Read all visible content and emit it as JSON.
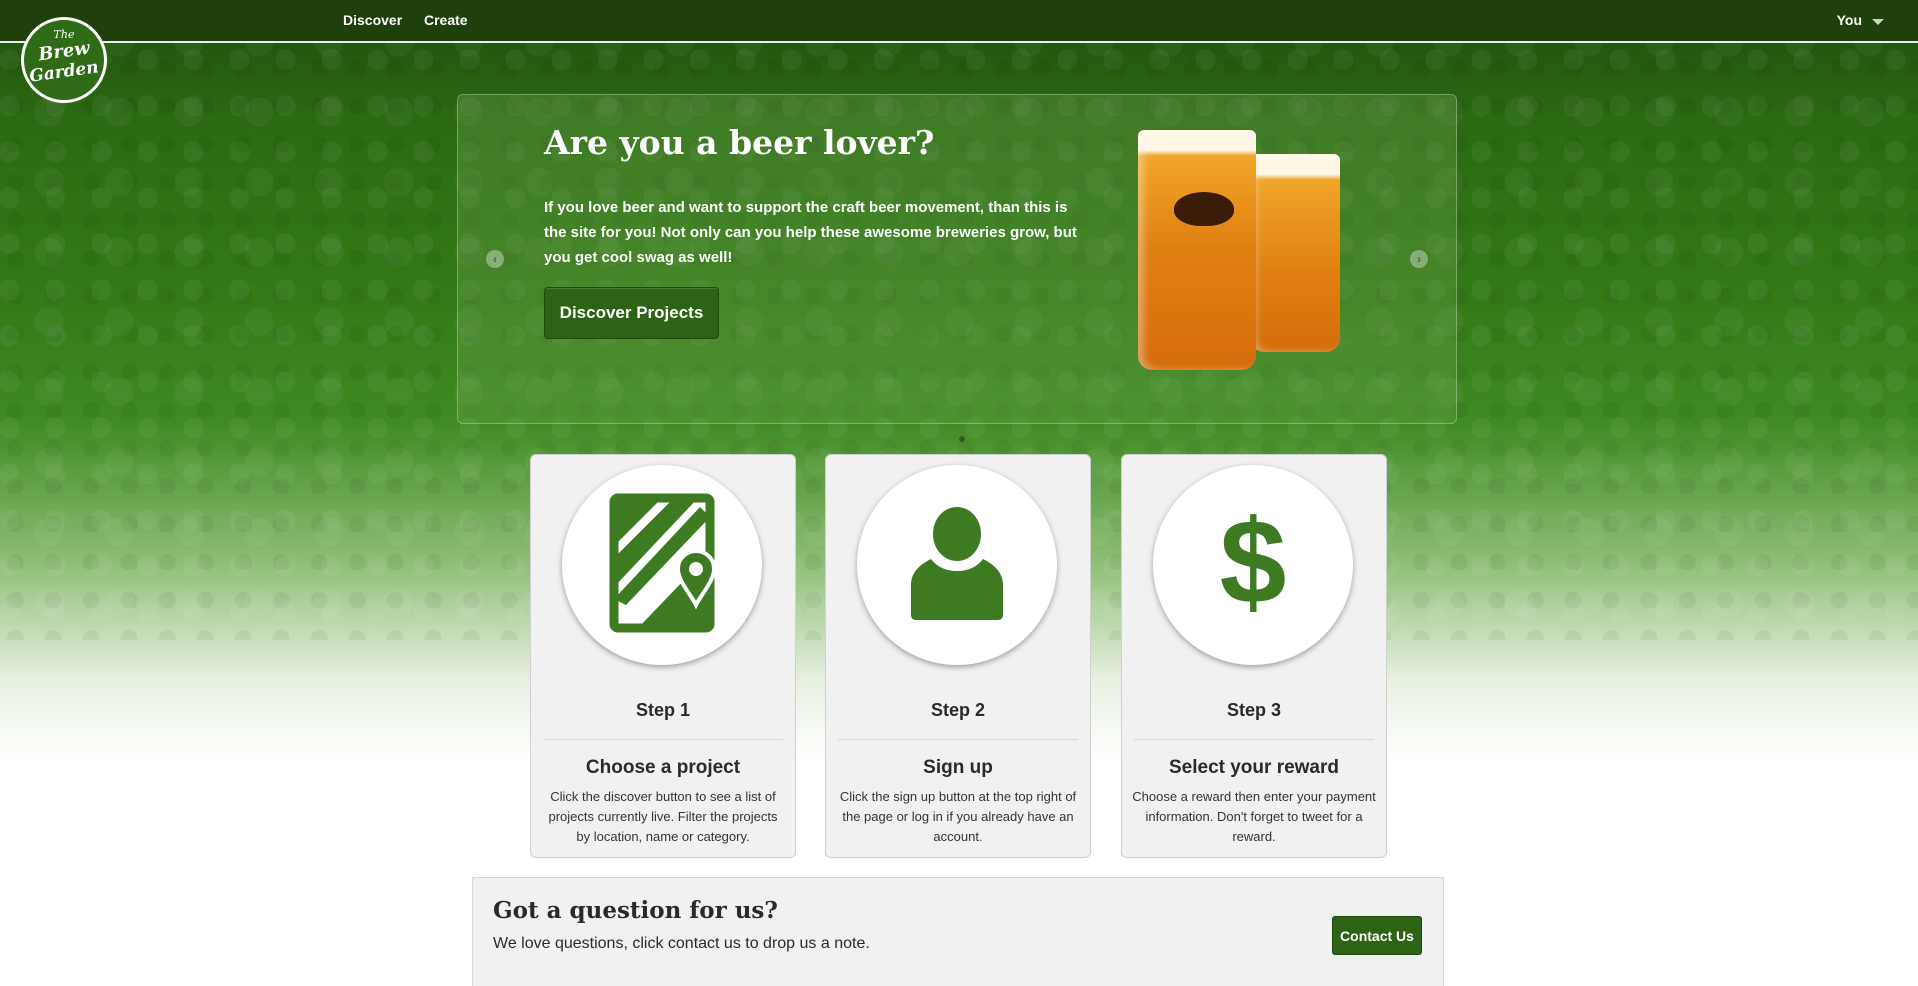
{
  "brand": {
    "logo_line1": "The",
    "logo_line2": "Brew",
    "logo_line3": "Garden"
  },
  "nav": {
    "discover": "Discover",
    "create": "Create",
    "you": "You"
  },
  "hero": {
    "title": "Are you a beer lover?",
    "text": "If you love beer and want to support the craft beer movement, than this is the site for you! Not only can you help these awesome breweries grow, but you get cool swag as well!",
    "button": "Discover Projects",
    "prev_arrow": "‹",
    "next_arrow": "›"
  },
  "steps": [
    {
      "title": "Step 1",
      "heading": "Choose a project",
      "description": "Click the discover button to see a list of projects currently live. Filter the projects by location, name or category.",
      "icon": "map-icon"
    },
    {
      "title": "Step 2",
      "heading": "Sign up",
      "description": "Click the sign up button at the top right of the page or log in if you already have an account.",
      "icon": "user-icon"
    },
    {
      "title": "Step 3",
      "heading": "Select your reward",
      "description": "Choose a reward then enter your payment information. Don't forget to tweet for a reward.",
      "icon": "dollar-icon"
    }
  ],
  "question": {
    "title": "Got a question for us?",
    "text": "We love questions, click contact us to drop us a note.",
    "button": "Contact Us"
  },
  "colors": {
    "brand_green": "#2e6214",
    "icon_green": "#3d7a22",
    "nav_bg": "#1f3f0c"
  }
}
